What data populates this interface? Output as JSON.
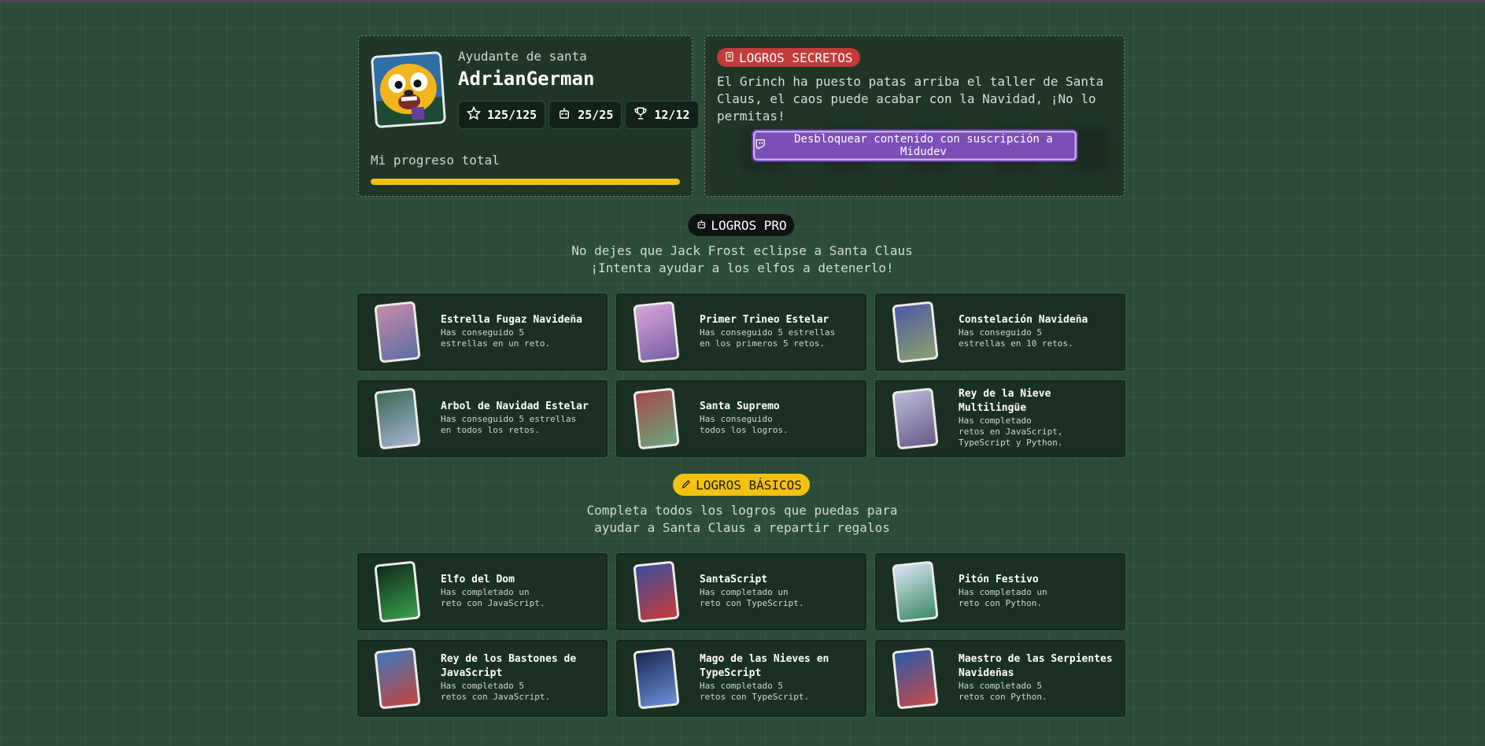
{
  "profile": {
    "role": "Ayudante de santa",
    "username": "AdrianGerman",
    "stats": [
      {
        "icon": "star-icon",
        "value": "125/125"
      },
      {
        "icon": "robot-icon",
        "value": "25/25"
      },
      {
        "icon": "trophy-icon",
        "value": "12/12"
      }
    ],
    "progress_label": "Mi progreso total",
    "progress_fraction": 1.0,
    "colors": {
      "progress": "#f4c20d"
    }
  },
  "secret": {
    "badge": "LOGROS SECRETOS",
    "text": "El Grinch ha puesto patas arriba el taller de Santa Claus, el caos puede acabar con la Navidad, ¡No lo permitas!",
    "unlock_button": "Desbloquear contenido con suscripción a Midudev",
    "colors": {
      "badge": "#c33b3b",
      "button": "#7b4fb5"
    }
  },
  "pro": {
    "badge": "LOGROS PRO",
    "subtitle_line1": "No dejes que Jack Frost eclipse a Santa Claus",
    "subtitle_line2": "¡Intenta ayudar a los elfos a detenerlo!",
    "cards": [
      {
        "title": "Estrella Fugaz Navideña",
        "desc": "Has conseguido 5\nestrellas en un reto."
      },
      {
        "title": "Primer Trineo Estelar",
        "desc": "Has conseguido 5 estrellas\nen los primeros 5 retos."
      },
      {
        "title": "Constelación Navideña",
        "desc": "Has conseguido 5\nestrellas en 10 retos."
      },
      {
        "title": "Arbol de Navidad Estelar",
        "desc": "Has conseguido 5 estrellas\nen todos los retos."
      },
      {
        "title": "Santa Supremo",
        "desc": "Has conseguido\ntodos los logros."
      },
      {
        "title": "Rey de la Nieve Multilingüe",
        "desc": "Has completado\nretos en JavaScript,\nTypeScript y Python."
      }
    ]
  },
  "basic": {
    "badge": "LOGROS BÁSICOS",
    "subtitle_line1": "Completa todos los logros que puedas para",
    "subtitle_line2": "ayudar a Santa Claus a repartir regalos",
    "cards": [
      {
        "title": "Elfo del Dom",
        "desc": "Has completado un\nreto con JavaScript."
      },
      {
        "title": "SantaScript",
        "desc": "Has completado un\nreto con TypeScript."
      },
      {
        "title": "Pitón Festivo",
        "desc": "Has completado un\nreto con Python."
      },
      {
        "title": "Rey de los Bastones de JavaScript",
        "desc": "Has completado 5\nretos con JavaScript."
      },
      {
        "title": "Mago de las Nieves en TypeScript",
        "desc": "Has completado 5\nretos con TypeScript."
      },
      {
        "title": "Maestro de las Serpientes Navideñas",
        "desc": "Has completado 5\nretos con Python."
      }
    ]
  }
}
